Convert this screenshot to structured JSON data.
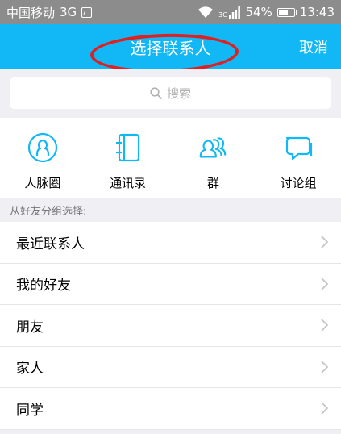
{
  "status_bar": {
    "carrier": "中国移动",
    "network": "3G",
    "signal_type": "3G",
    "battery": "54%",
    "battery_level": 0.54,
    "time": "13:43"
  },
  "header": {
    "title": "选择联系人",
    "cancel_label": "取消"
  },
  "search": {
    "placeholder": "搜索"
  },
  "quick_actions": [
    {
      "label": "人脉圈",
      "icon": "contact-circle-icon"
    },
    {
      "label": "通讯录",
      "icon": "address-book-icon"
    },
    {
      "label": "群",
      "icon": "group-icon"
    },
    {
      "label": "讨论组",
      "icon": "discussion-icon"
    }
  ],
  "section_label": "从好友分组选择:",
  "groups": [
    {
      "label": "最近联系人"
    },
    {
      "label": "我的好友"
    },
    {
      "label": "朋友"
    },
    {
      "label": "家人"
    },
    {
      "label": "同学"
    }
  ],
  "colors": {
    "brand": "#12b7f5",
    "annotation": "#e0201f",
    "status_bar": "#8c8c8c"
  }
}
